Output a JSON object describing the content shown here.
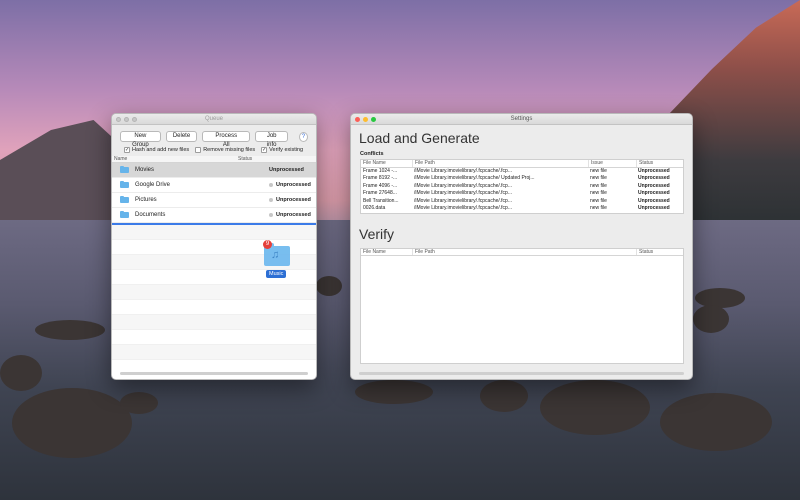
{
  "queue": {
    "title": "Queue",
    "toolbar": {
      "new_group": "New Group",
      "delete": "Delete",
      "process_all": "Process All",
      "job_info": "Job info",
      "help": "?"
    },
    "options": [
      {
        "label": "Hash and add new files",
        "checked": true
      },
      {
        "label": "Remove missing files",
        "checked": false
      },
      {
        "label": "Verify existing",
        "checked": true
      }
    ],
    "columns": {
      "name": "Name",
      "status": "Status"
    },
    "rows": [
      {
        "name": "Movies",
        "status": "Unprocessed",
        "selected": true
      },
      {
        "name": "Google Drive",
        "status": "Unprocessed",
        "selected": false
      },
      {
        "name": "Pictures",
        "status": "Unprocessed",
        "selected": false
      },
      {
        "name": "Documents",
        "status": "Unprocessed",
        "selected": false
      }
    ],
    "drag_item": {
      "label": "Music",
      "badge": "9"
    }
  },
  "settings": {
    "title": "Settings",
    "section1_title": "Load and Generate",
    "conflicts_label": "Conflicts",
    "columns": {
      "file_name": "File Name",
      "file_path": "File Path",
      "issue": "Issue",
      "status": "Status"
    },
    "conflicts": [
      {
        "file_name": "Frame 1024 -...",
        "file_path": "/iMovie Library.imovielibrary/.fcpcache/.fcp...",
        "issue": "new file",
        "status": "Unprocessed"
      },
      {
        "file_name": "Frame 8192 -...",
        "file_path": "/iMovie Library.imovielibrary/.fcpcache/ Updated Proj...",
        "issue": "new file",
        "status": "Unprocessed"
      },
      {
        "file_name": "Frame 4096 -...",
        "file_path": "/iMovie Library.imovielibrary/.fcpcache/.fcp...",
        "issue": "new file",
        "status": "Unprocessed"
      },
      {
        "file_name": "Frame 27648...",
        "file_path": "/iMovie Library.imovielibrary/.fcpcache/.fcp...",
        "issue": "new file",
        "status": "Unprocessed"
      },
      {
        "file_name": "Bell Transition...",
        "file_path": "/iMovie Library.imovielibrary/.fcpcache/.fcp...",
        "issue": "new file",
        "status": "Unprocessed"
      },
      {
        "file_name": "0026.data",
        "file_path": "/iMovie Library.imovielibrary/.fcpcache/.fcp...",
        "issue": "new file",
        "status": "Unprocessed"
      }
    ],
    "section2_title": "Verify",
    "verify_columns": {
      "file_name": "File Name",
      "file_path": "File Path",
      "status": "Status"
    }
  }
}
